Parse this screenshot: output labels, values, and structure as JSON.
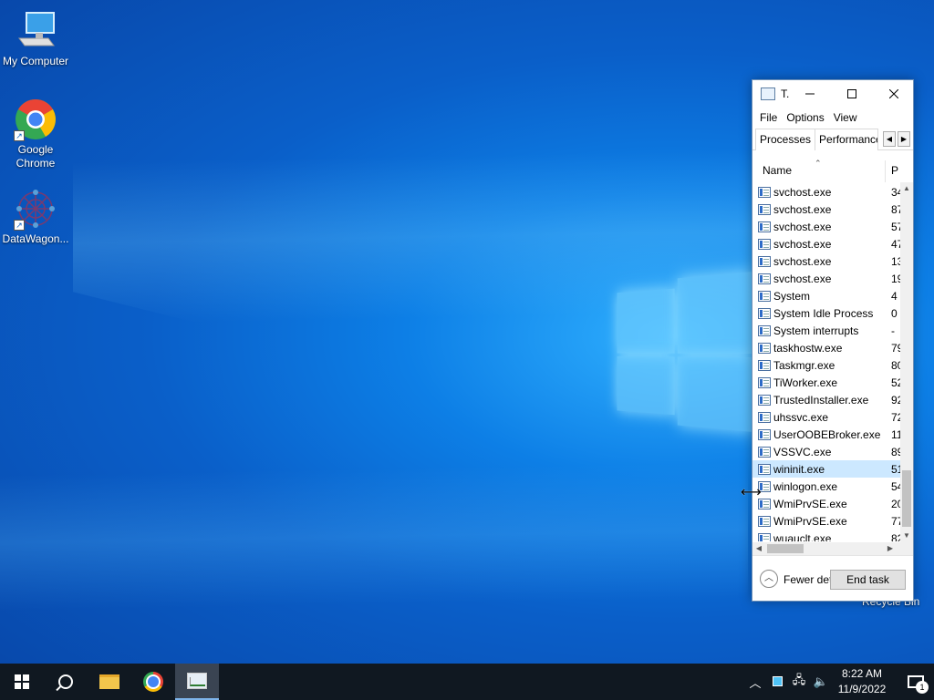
{
  "desktop": {
    "icons": [
      {
        "label": "My Computer"
      },
      {
        "label": "Google Chrome"
      },
      {
        "label": "DataWagon..."
      }
    ],
    "recycle_bin_label": "Recycle Bin"
  },
  "task_manager": {
    "title": "T.",
    "menu": [
      "File",
      "Options",
      "View"
    ],
    "tabs": [
      "Processes",
      "Performance"
    ],
    "columns": {
      "name": "Name",
      "p": "P"
    },
    "processes": [
      {
        "name": "svchost.exe",
        "p": "34"
      },
      {
        "name": "svchost.exe",
        "p": "87"
      },
      {
        "name": "svchost.exe",
        "p": "57"
      },
      {
        "name": "svchost.exe",
        "p": "47"
      },
      {
        "name": "svchost.exe",
        "p": "13"
      },
      {
        "name": "svchost.exe",
        "p": "19"
      },
      {
        "name": "System",
        "p": "4"
      },
      {
        "name": "System Idle Process",
        "p": "0"
      },
      {
        "name": "System interrupts",
        "p": "-"
      },
      {
        "name": "taskhostw.exe",
        "p": "79"
      },
      {
        "name": "Taskmgr.exe",
        "p": "80"
      },
      {
        "name": "TiWorker.exe",
        "p": "52"
      },
      {
        "name": "TrustedInstaller.exe",
        "p": "92"
      },
      {
        "name": "uhssvc.exe",
        "p": "72"
      },
      {
        "name": "UserOOBEBroker.exe",
        "p": "11"
      },
      {
        "name": "VSSVC.exe",
        "p": "89"
      },
      {
        "name": "wininit.exe",
        "p": "51"
      },
      {
        "name": "winlogon.exe",
        "p": "54"
      },
      {
        "name": "WmiPrvSE.exe",
        "p": "20"
      },
      {
        "name": "WmiPrvSE.exe",
        "p": "77"
      },
      {
        "name": "wuauclt.exe",
        "p": "82"
      }
    ],
    "selected_process": "wininit.exe",
    "fewer_details_label": "Fewer details",
    "end_task_label": "End task"
  },
  "taskbar": {
    "time": "8:22 AM",
    "date": "11/9/2022",
    "notification_count": "1"
  }
}
